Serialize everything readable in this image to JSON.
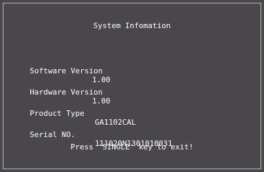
{
  "window": {
    "title": "System Infomation"
  },
  "info": {
    "software": {
      "label": "Software Version",
      "value": "1.00"
    },
    "hardware": {
      "label": "Hardware Version",
      "value": "1.00"
    },
    "product": {
      "label": "Product Type",
      "value": "GA1102CAL"
    },
    "serial": {
      "label": "Serial NO.",
      "value": "111020N1301010031"
    }
  },
  "footer": {
    "hint": "Press 'SINGLE' key to exit!"
  },
  "colors": {
    "background": "#4a474c",
    "text": "#ffffff",
    "border": "#b8b8b8"
  }
}
